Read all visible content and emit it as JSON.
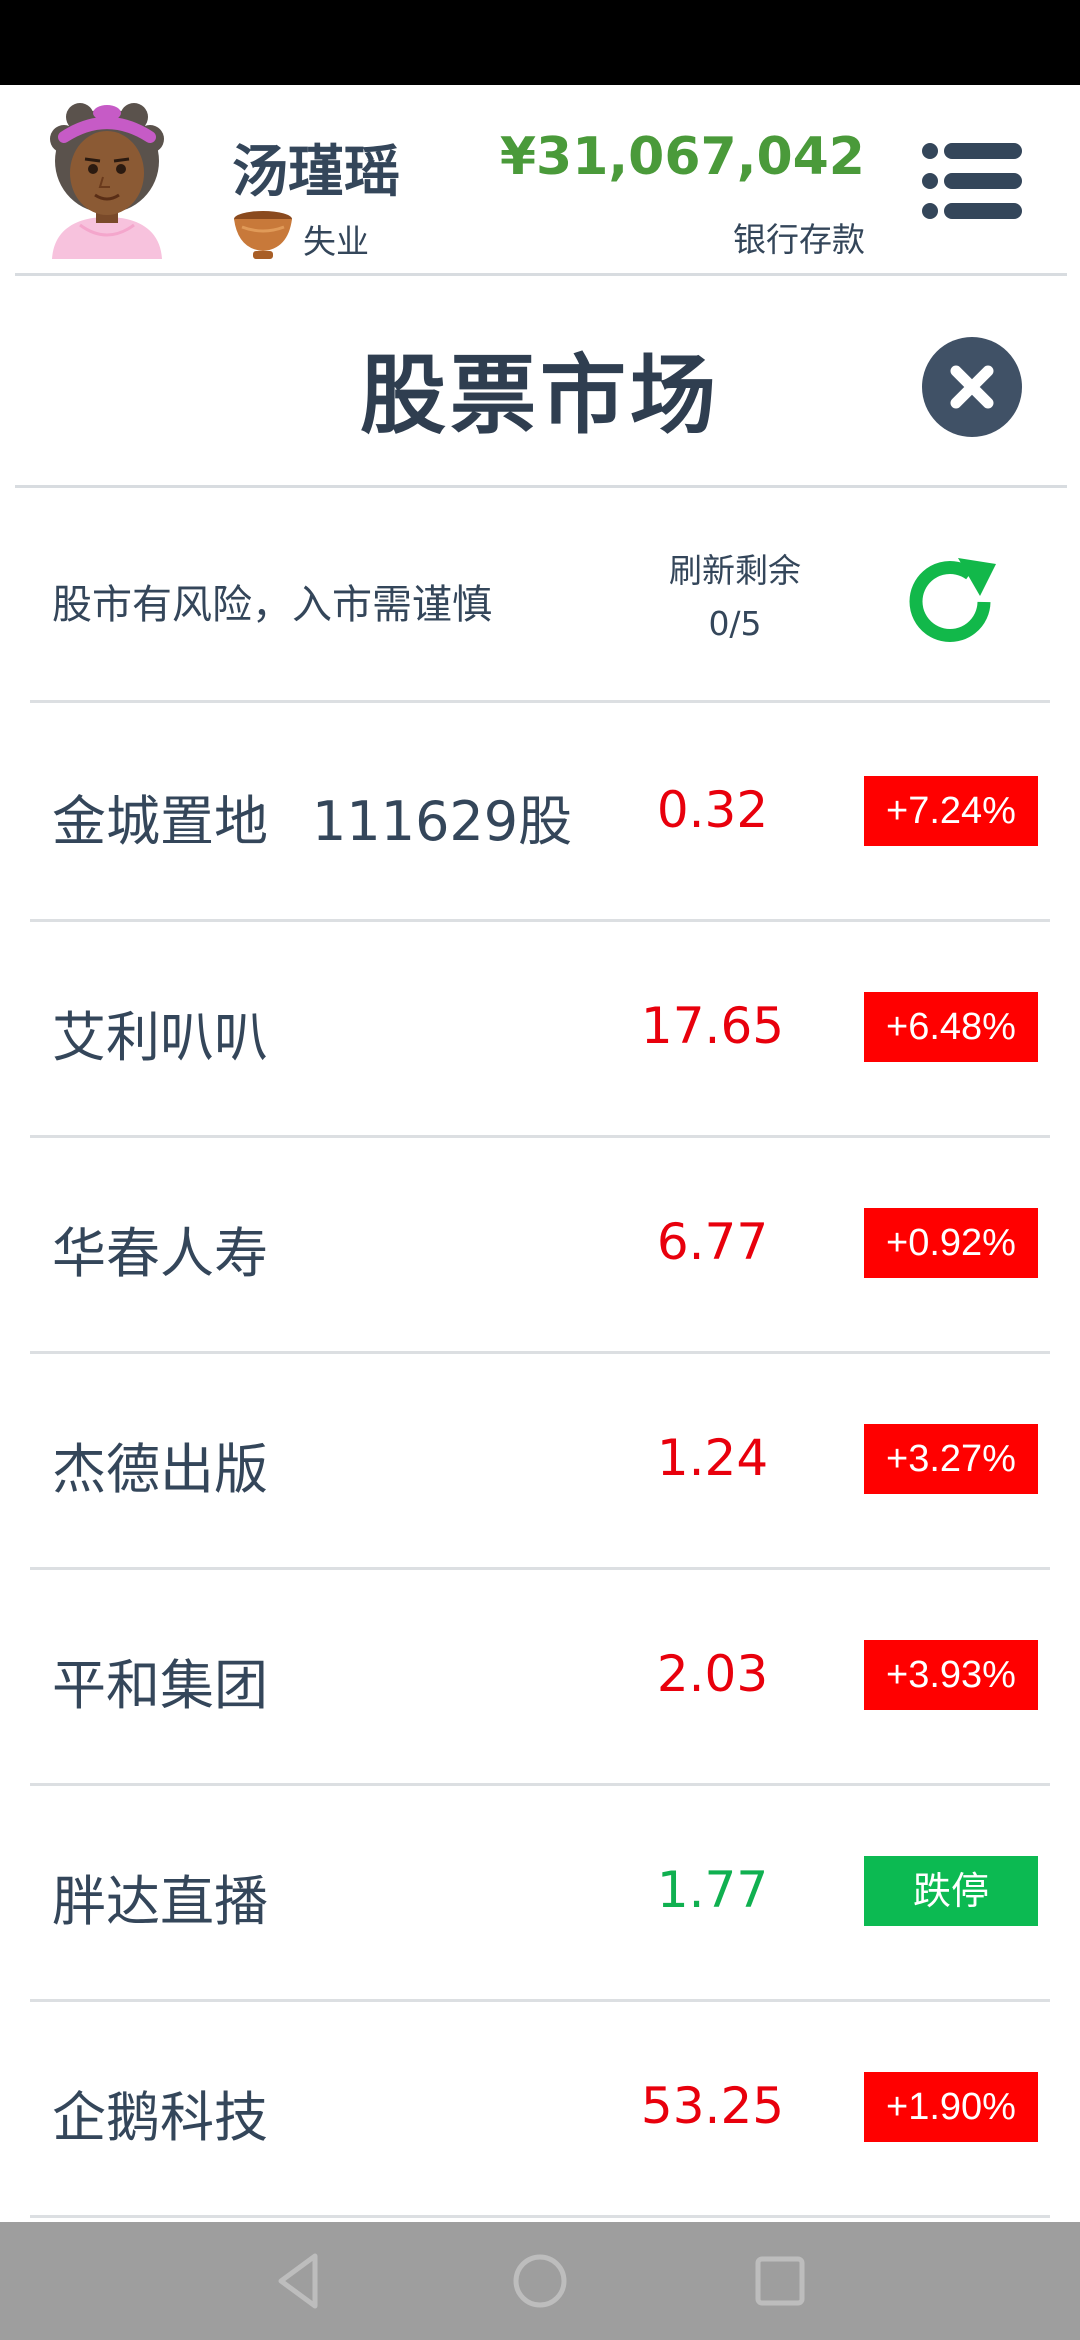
{
  "header": {
    "player_name": "汤瑾瑶",
    "job": "失业",
    "money": "¥31,067,042",
    "money_label": "银行存款"
  },
  "title": "股票市场",
  "info": {
    "risk_warning": "股市有风险，入市需谨慎",
    "refresh_label": "刷新剩余",
    "refresh_count": "0/5"
  },
  "stocks": [
    {
      "name": "金城置地",
      "shares": "111629股",
      "price": "0.32",
      "change": "+7.24%",
      "trend": "up"
    },
    {
      "name": "艾利叭叭",
      "shares": "",
      "price": "17.65",
      "change": "+6.48%",
      "trend": "up"
    },
    {
      "name": "华春人寿",
      "shares": "",
      "price": "6.77",
      "change": "+0.92%",
      "trend": "up"
    },
    {
      "name": "杰德出版",
      "shares": "",
      "price": "1.24",
      "change": "+3.27%",
      "trend": "up"
    },
    {
      "name": "平和集团",
      "shares": "",
      "price": "2.03",
      "change": "+3.93%",
      "trend": "up"
    },
    {
      "name": "胖达直播",
      "shares": "",
      "price": "1.77",
      "change": "跌停",
      "trend": "down"
    },
    {
      "name": "企鹅科技",
      "shares": "",
      "price": "53.25",
      "change": "+1.90%",
      "trend": "up"
    }
  ],
  "colors": {
    "up": "#e8000c",
    "up_badge": "#ff0000",
    "down": "#10b050",
    "down_badge": "#0cba52",
    "money": "#4a9a3a"
  },
  "icons": {
    "avatar": "avatar-icon",
    "job": "bowl-icon",
    "menu": "menu-icon",
    "close": "close-icon",
    "refresh": "refresh-icon",
    "nav_back": "back-icon",
    "nav_home": "home-icon",
    "nav_recent": "recent-apps-icon"
  }
}
